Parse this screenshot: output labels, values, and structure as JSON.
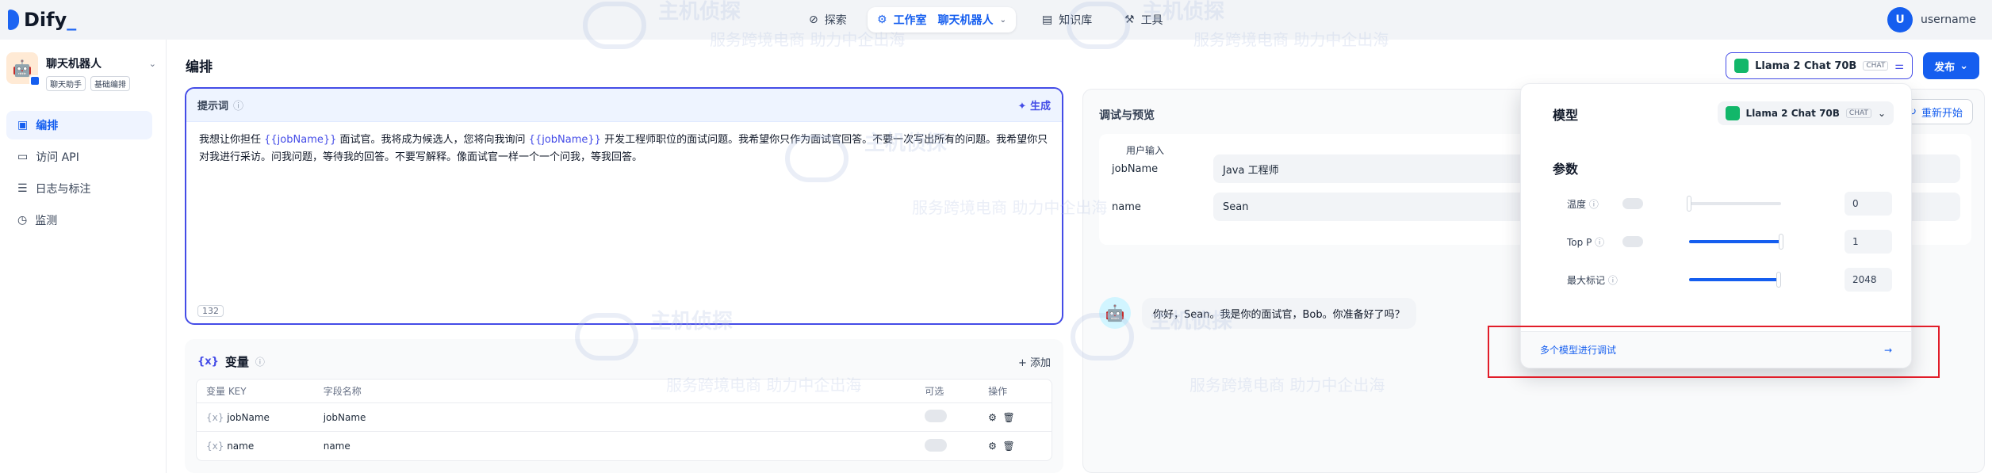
{
  "logo": {
    "text": "Dify",
    "accent": "_"
  },
  "nav": {
    "explore": "探索",
    "studio": "工作室",
    "app_crumb": "聊天机器人",
    "knowledge": "知识库",
    "tools": "工具"
  },
  "user": {
    "avatar_letter": "U",
    "name": "username"
  },
  "sidebar": {
    "app_name": "聊天机器人",
    "tag1": "聊天助手",
    "tag2": "基础编排",
    "items": [
      {
        "label": "编排"
      },
      {
        "label": "访问 API"
      },
      {
        "label": "日志与标注"
      },
      {
        "label": "监测"
      }
    ]
  },
  "page": {
    "title": "编排"
  },
  "prompt": {
    "title": "提示词",
    "generate": "生成",
    "text_a": "我想让你担任 ",
    "var1": "{{jobName}}",
    "text_b": " 面试官。我将成为候选人，您将向我询问 ",
    "var2": "{{jobName}}",
    "text_c": " 开发工程师职位的面试问题。我希望你只作为面试官回答。不要一次写出所有的问题。我希望你只对我进行采访。问我问题，等待我的回答。不要写解释。像面试官一样一个一个问我，等我回答。",
    "count": "132"
  },
  "variables": {
    "title": "变量",
    "add": "添加",
    "headers": [
      "变量 KEY",
      "字段名称",
      "可选",
      "操作"
    ],
    "rows": [
      {
        "key": "jobName",
        "name": "jobName"
      },
      {
        "key": "name",
        "name": "name"
      }
    ]
  },
  "debug": {
    "title": "调试与预览",
    "restart": "重新开始",
    "user_input": "用户输入",
    "fields": [
      {
        "key": "jobName",
        "value": "Java 工程师"
      },
      {
        "key": "name",
        "value": "Sean"
      }
    ],
    "greeting": "你好，Sean。我是你的面试官，Bob。你准备好了吗？"
  },
  "header_model": {
    "name": "Llama 2 Chat 70B",
    "tag": "CHAT"
  },
  "publish": "发布",
  "popup": {
    "model_title": "模型",
    "model_name": "Llama 2 Chat 70B",
    "model_tag": "CHAT",
    "params_title": "参数",
    "params": [
      {
        "label": "温度",
        "value": "0",
        "fraction": 0.0
      },
      {
        "label": "Top P",
        "value": "1",
        "fraction": 1.0
      },
      {
        "label": "最大标记",
        "value": "2048",
        "fraction": 0.97
      }
    ],
    "multi": "多个模型进行调试",
    "arrow": "→"
  },
  "watermark": {
    "line1": "主机侦探",
    "line2": "服务跨境电商  助力中企出海"
  },
  "colors": {
    "primary": "#155eef",
    "prompt_border": "#444ce7",
    "highlight": "#e11d29"
  }
}
